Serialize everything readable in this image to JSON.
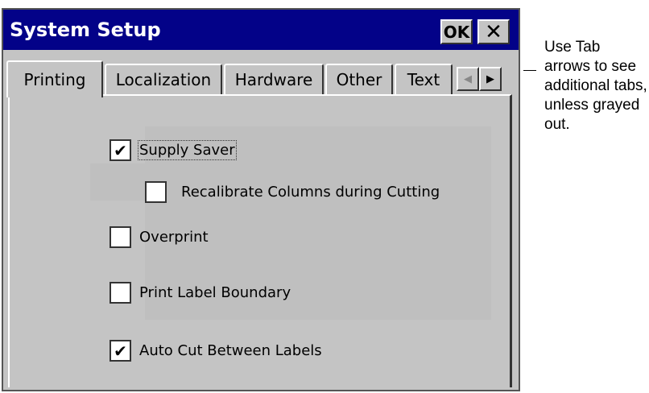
{
  "window": {
    "title": "System Setup",
    "ok_label": "OK",
    "close_glyph": "✕"
  },
  "tabs": [
    {
      "label": "Printing",
      "active": true
    },
    {
      "label": "Localization",
      "active": false
    },
    {
      "label": "Hardware",
      "active": false
    },
    {
      "label": "Other",
      "active": false
    },
    {
      "label": "Text",
      "active": false
    }
  ],
  "tab_arrows": {
    "left_glyph": "◀",
    "right_glyph": "▶",
    "left_enabled": false,
    "right_enabled": true
  },
  "options": [
    {
      "label": "Supply Saver",
      "checked": true
    },
    {
      "label": "Recalibrate Columns during Cutting",
      "checked": false
    },
    {
      "label": "Overprint",
      "checked": false
    },
    {
      "label": "Print Label Boundary",
      "checked": false
    },
    {
      "label": "Auto Cut Between Labels",
      "checked": true
    }
  ],
  "check_glyph": "✔",
  "callout": {
    "text": "Use Tab arrows to see additional tabs, unless grayed out."
  },
  "colors": {
    "titlebar": "#030288",
    "window_bg": "#c4c4c4"
  }
}
